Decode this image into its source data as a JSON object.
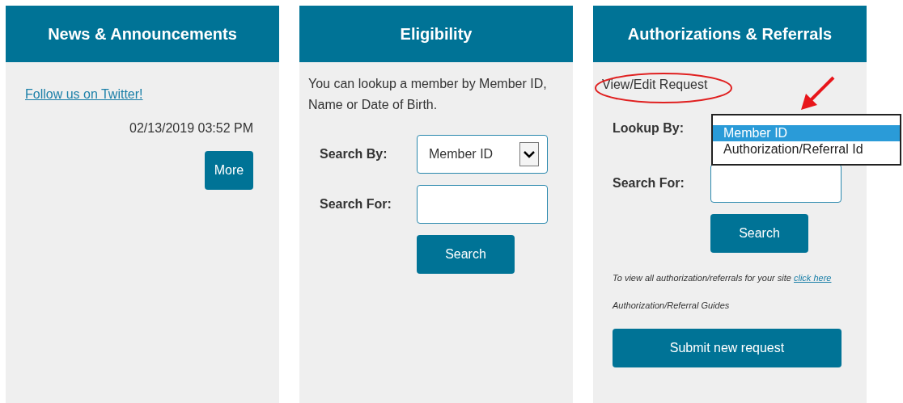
{
  "news": {
    "title": "News & Announcements",
    "link": "Follow us on Twitter!",
    "timestamp": "02/13/2019 03:52 PM",
    "more_button": "More"
  },
  "eligibility": {
    "title": "Eligibility",
    "intro": "You can lookup a member by Member ID, Name or Date of Birth.",
    "search_by_label": "Search By:",
    "search_by_value": "Member ID",
    "search_for_label": "Search For:",
    "search_button": "Search"
  },
  "authorizations": {
    "title": "Authorizations & Referrals",
    "view_edit_link": "View/Edit Request",
    "lookup_by_label": "Lookup By:",
    "lookup_options": [
      {
        "label": "Member ID",
        "selected": true
      },
      {
        "label": "Authorization/Referral Id",
        "selected": false
      }
    ],
    "search_for_label": "Search For:",
    "search_button": "Search",
    "note": "To view all authorization/referrals for your site",
    "note_link": "click here",
    "guides": "Authorization/Referral Guides",
    "submit_button": "Submit new request"
  }
}
